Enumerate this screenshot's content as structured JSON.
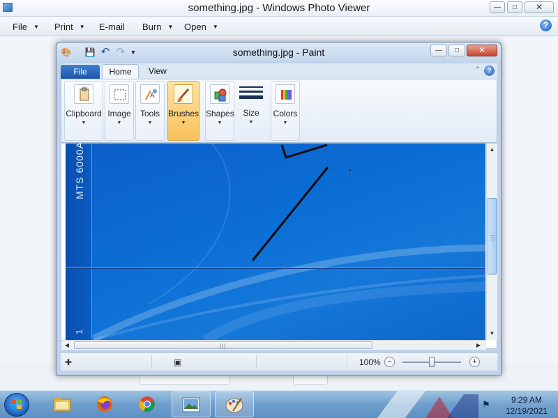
{
  "photo_viewer": {
    "title": "something.jpg - Windows Photo Viewer",
    "menu": [
      {
        "label": "File",
        "has_caret": true
      },
      {
        "label": "Print",
        "has_caret": true
      },
      {
        "label": "E-mail",
        "has_caret": false
      },
      {
        "label": "Burn",
        "has_caret": true
      },
      {
        "label": "Open",
        "has_caret": true
      }
    ],
    "help_icon": "help-icon"
  },
  "paint": {
    "title": "something.jpg - Paint",
    "tabs": {
      "file": "File",
      "home": "Home",
      "view": "View"
    },
    "ribbon_groups": [
      {
        "label": "Clipboard",
        "icon": "clipboard-icon",
        "active": false
      },
      {
        "label": "Image",
        "icon": "image-select-icon",
        "active": false
      },
      {
        "label": "Tools",
        "icon": "tools-icon",
        "active": false
      },
      {
        "label": "Brushes",
        "icon": "brush-icon",
        "active": true
      },
      {
        "label": "Shapes",
        "icon": "shapes-icon",
        "active": false
      },
      {
        "label": "Size",
        "icon": "line-size-icon",
        "active": false
      },
      {
        "label": "Colors",
        "icon": "color-palette-icon",
        "active": false
      }
    ],
    "canvas": {
      "side_text": "MTS 6000A",
      "side_text_bottom": "1",
      "background_color": "#0b6fd6"
    },
    "status": {
      "zoom": "100%"
    }
  },
  "taskbar": {
    "apps": [
      {
        "name": "file-explorer-icon"
      },
      {
        "name": "firefox-icon"
      },
      {
        "name": "chrome-icon"
      },
      {
        "name": "photo-viewer-icon",
        "pinned": true
      },
      {
        "name": "paint-icon",
        "pinned": true
      }
    ],
    "clock": {
      "time": "9:29 AM",
      "date": "12/19/2021"
    }
  }
}
